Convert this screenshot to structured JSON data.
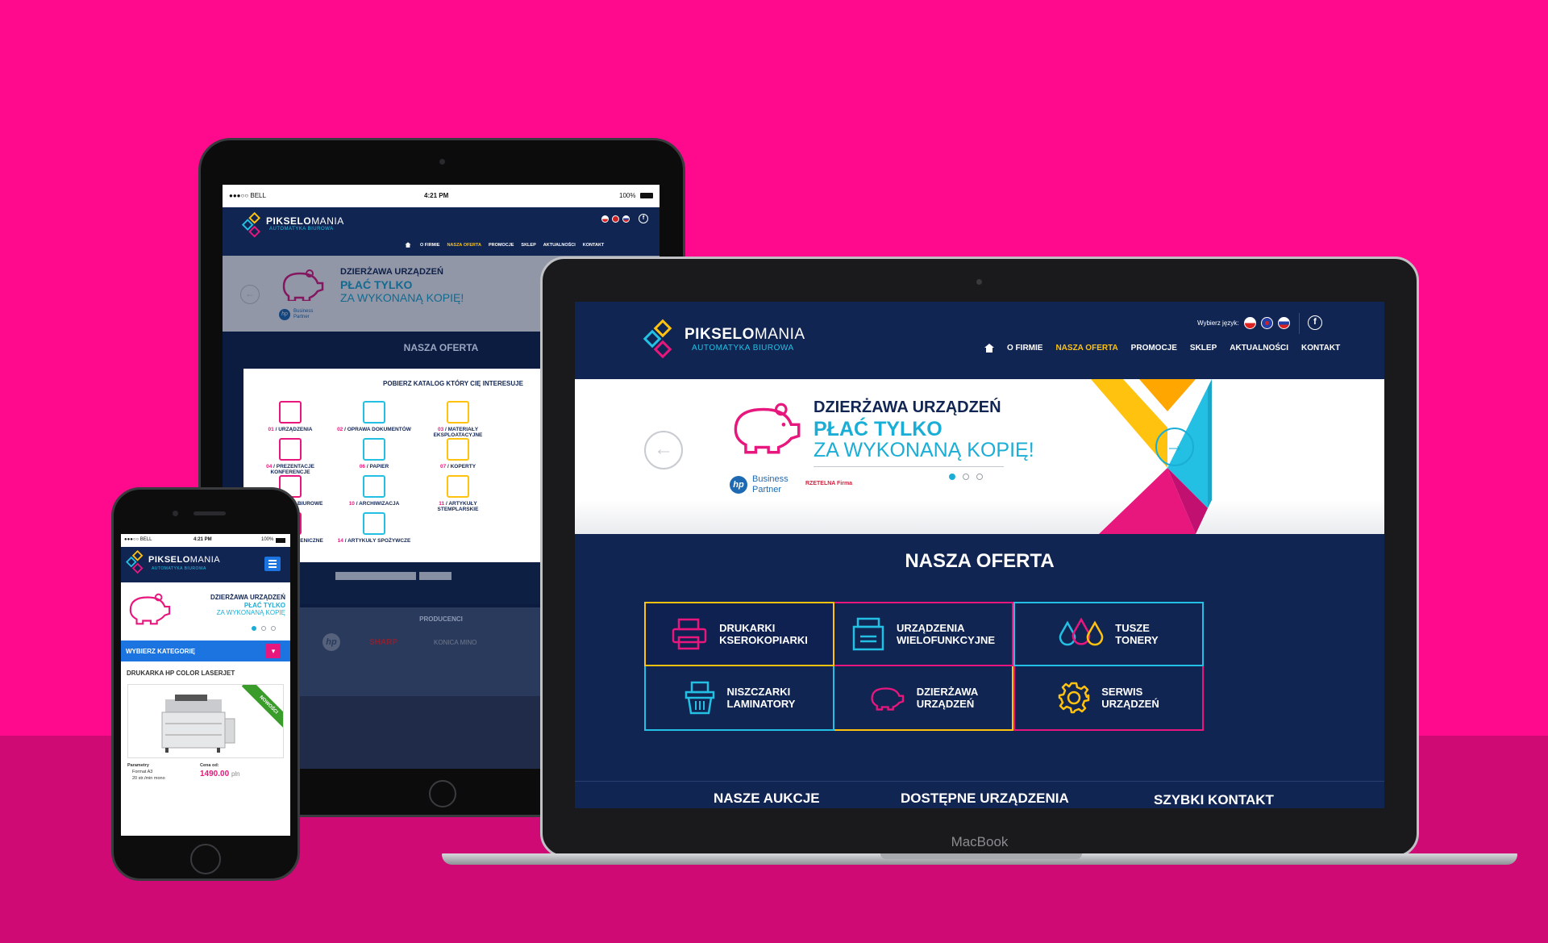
{
  "brand": {
    "name_bold": "PIKSELO",
    "name_light": "MANIA",
    "tagline": "AUTOMATYKA BIUROWA"
  },
  "laptop": {
    "device_label": "MacBook",
    "lang_label": "Wybierz język:",
    "nav": [
      "O FIRMIE",
      "NASZA OFERTA",
      "PROMOCJE",
      "SKLEP",
      "AKTUALNOŚCI",
      "KONTAKT"
    ],
    "nav_active": "NASZA OFERTA",
    "hero": {
      "title": "DZIERŻAWA URZĄDZEŃ",
      "line1": "PŁAĆ TYLKO",
      "line2": "ZA WYKONANĄ KOPIĘ!",
      "partner1_a": "Business",
      "partner1_b": "Partner",
      "partner2": "RZETELNA Firma"
    },
    "offer_title": "NASZA OFERTA",
    "tiles": [
      {
        "l1": "DRUKARKI",
        "l2": "KSEROKOPIARKI",
        "icon": "printer-icon",
        "color": "#e8177d"
      },
      {
        "l1": "URZĄDZENIA",
        "l2": "WIELOFUNKCYJNE",
        "icon": "multifunction-device-icon",
        "color": "#23c0e3"
      },
      {
        "l1": "TUSZE",
        "l2": "TONERY",
        "icon": "ink-drops-icon",
        "color": "#23c0e3"
      },
      {
        "l1": "NISZCZARKI",
        "l2": "LAMINATORY",
        "icon": "shredder-icon",
        "color": "#23c0e3"
      },
      {
        "l1": "DZIERŻAWA",
        "l2": "URZĄDZEŃ",
        "icon": "piggy-bank-icon",
        "color": "#e8177d"
      },
      {
        "l1": "SERWIS",
        "l2": "URZĄDZEŃ",
        "icon": "gear-icon",
        "color": "#ffc20e"
      }
    ],
    "bottom": [
      "NASZE AUKCJE",
      "DOSTĘPNE URZĄDZENIA",
      "SZYBKI KONTAKT"
    ]
  },
  "tablet": {
    "status": {
      "carrier": "●●●○○ BELL",
      "time": "4:21 PM",
      "battery": "100%"
    },
    "nav": [
      "O FIRMIE",
      "NASZA OFERTA",
      "PROMOCJE",
      "SKLEP",
      "AKTUALNOŚCI",
      "KONTAKT"
    ],
    "hero": {
      "title": "DZIERŻAWA URZĄDZEŃ",
      "line1": "PŁAĆ TYLKO",
      "line2": "ZA WYKONANĄ KOPIĘ!",
      "partner1_a": "Business",
      "partner1_b": "Partner"
    },
    "offer_title": "NASZA OFERTA",
    "modal_title": "POBIERZ KATALOG KTÓRY CIĘ INTERESUJE",
    "cats": [
      {
        "n": "01",
        "label": "URZĄDZENIA"
      },
      {
        "n": "02",
        "label": "OPRAWA DOKUMENTÓW"
      },
      {
        "n": "03",
        "label": "MATERIAŁY EKSPLOATACYJNE"
      },
      {
        "n": "04",
        "label": "PREZENTACJE KONFERENCJE"
      },
      {
        "n": "06",
        "label": "PAPIER"
      },
      {
        "n": "07",
        "label": "KOPERTY"
      },
      {
        "n": "09",
        "label": "ARTYKUŁY BIUROWE"
      },
      {
        "n": "10",
        "label": "ARCHIWIZACJA"
      },
      {
        "n": "11",
        "label": "ARTYKUŁY STEMPLARSKIE"
      },
      {
        "n": "13",
        "label": "ŚRODKI HIGIENICZNE"
      },
      {
        "n": "14",
        "label": "ARTYKUŁY SPOŻYWCZE"
      }
    ],
    "producers_title": "PRODUCENCI",
    "producers": [
      "K",
      "hp",
      "SHARP",
      "KONICA MINO"
    ]
  },
  "phone": {
    "status": {
      "carrier": "●●●○○ BELL",
      "time": "4:21 PM",
      "battery": "100%"
    },
    "hero": {
      "title": "DZIERŻAWA URZĄDZEŃ",
      "line1": "PŁAĆ TYLKO",
      "line2": "ZA WYKONANĄ KOPIĘ"
    },
    "category_label": "WYBIERZ KATEGORIĘ",
    "product_title": "DRUKARKA HP COLOR LASERJET",
    "badge": "NOWOŚCI",
    "params_label": "Parametry",
    "params": [
      "Format A3",
      "20 str./min mono"
    ],
    "price_label": "Cena od:",
    "price": "1490.00",
    "currency": "pln"
  }
}
